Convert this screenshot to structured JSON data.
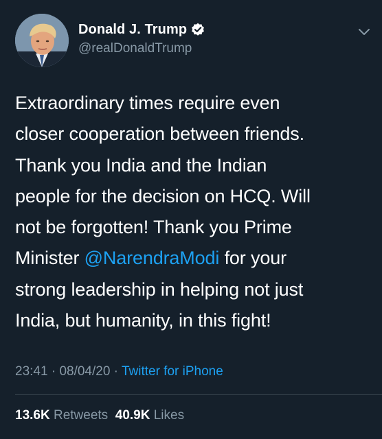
{
  "author": {
    "display_name": "Donald J. Trump",
    "handle": "@realDonaldTrump",
    "verified": true
  },
  "tweet": {
    "lines": [
      "Extraordinary times require even",
      "closer cooperation between friends.",
      "Thank you India and the Indian",
      "people for the decision on HCQ. Will",
      "not be forgotten! Thank you Prime"
    ],
    "line6_before": "Minister ",
    "mention": "@NarendraModi",
    "line6_after": " for your",
    "lines_end": [
      "strong leadership in helping not just",
      "India, but humanity, in this fight!"
    ]
  },
  "meta": {
    "time": "23:41",
    "sep1": " · ",
    "date": "08/04/20",
    "sep2": " · ",
    "source": "Twitter for iPhone"
  },
  "stats": {
    "retweets_count": "13.6K",
    "retweets_label": "Retweets",
    "likes_count": "40.9K",
    "likes_label": "Likes"
  },
  "colors": {
    "background": "#15202b",
    "text": "#ffffff",
    "secondary": "#8899a6",
    "accent": "#1da1f2"
  },
  "icons": {
    "verified": "verified-badge-icon",
    "caret": "chevron-down-icon"
  }
}
